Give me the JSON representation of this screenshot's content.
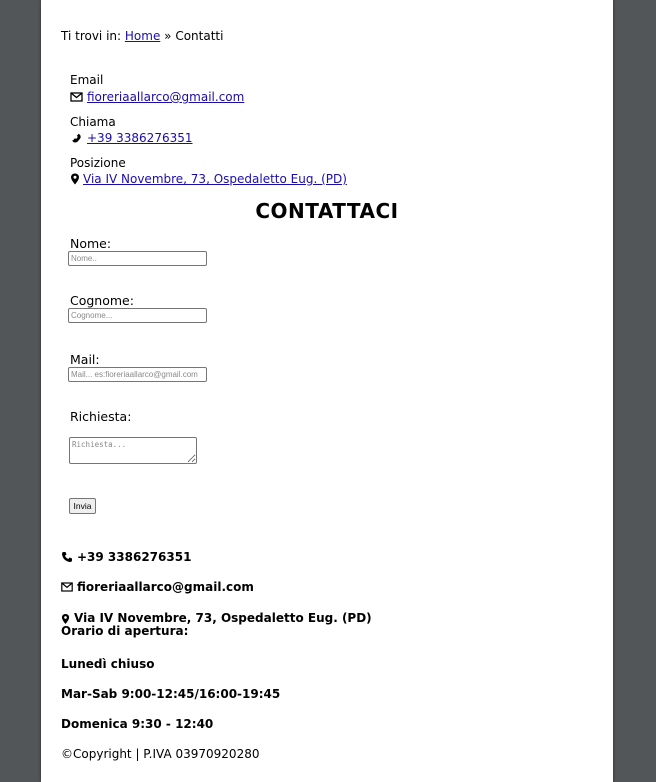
{
  "breadcrumb": {
    "prefix": "Ti trovi in:",
    "home_link": "Home",
    "separator": "»",
    "current": "Contatti"
  },
  "contact_info": {
    "email": {
      "label": "Email",
      "value": "fioreriaallarco@gmail.com",
      "icon": "envelope-icon"
    },
    "phone": {
      "label": "Chiama",
      "value": "+39 3386276351",
      "icon": "phone-icon"
    },
    "location": {
      "label": "Posizione",
      "value": "Via IV Novembre, 73, Ospedaletto Eug. (PD)",
      "icon": "map-pin-icon"
    }
  },
  "form": {
    "title": "CONTATTACI",
    "name_label": "Nome:",
    "name_placeholder": "Nome..",
    "surname_label": "Cognome:",
    "surname_placeholder": "Cognome...",
    "mail_label": "Mail:",
    "mail_placeholder": "Mail... es:fioreriaallarco@gmail.com",
    "request_label": "Richiesta:",
    "request_placeholder": "Richiesta...",
    "submit_label": "Invia"
  },
  "footer": {
    "phone": "+39 3386276351",
    "email": "fioreriaallarco@gmail.com",
    "address": "Via IV Novembre, 73, Ospedaletto Eug. (PD)",
    "hours_title": "Orario di apertura:",
    "monday": "Lunedì chiuso",
    "tue_sat": "Mar-Sab 9:00-12:45/16:00-19:45",
    "sunday": "Domenica 9:30 - 12:40",
    "copyright": "©Copyright | P.IVA 03970920280"
  },
  "colors": {
    "viewer_background": "#535659",
    "page_background": "#ffffff",
    "link": "#1a0dab"
  }
}
